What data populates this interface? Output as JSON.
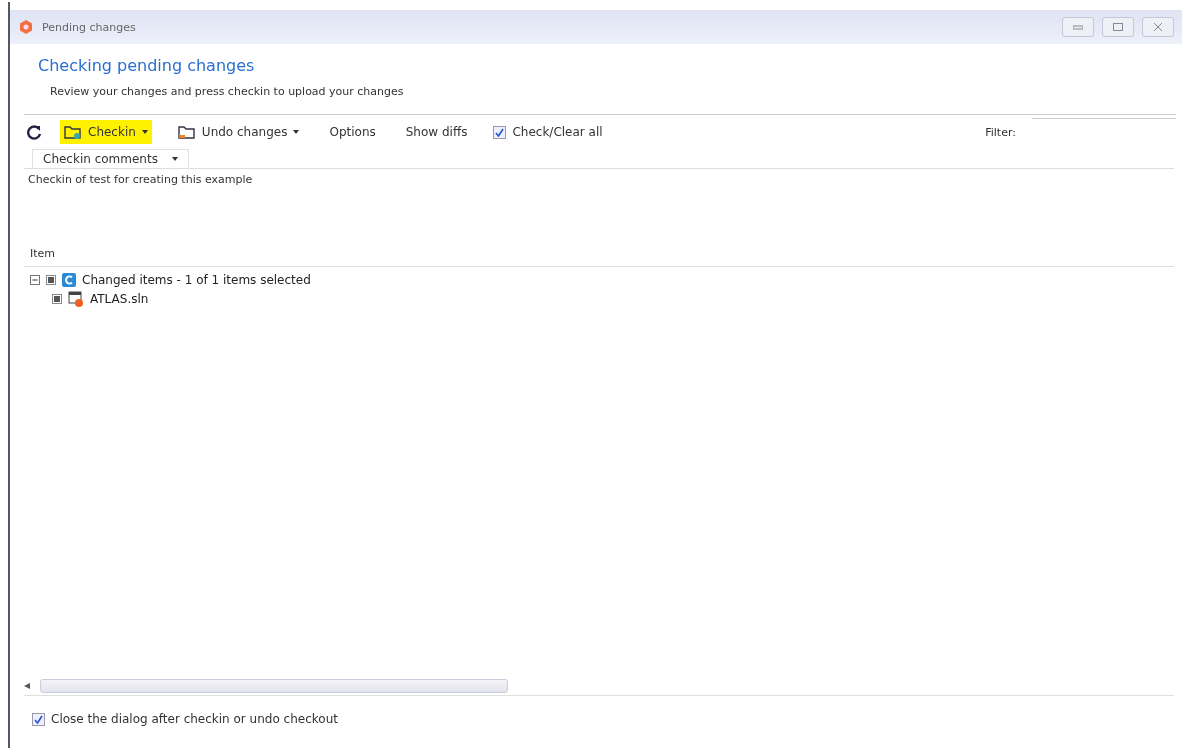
{
  "window": {
    "title": "Pending changes"
  },
  "header": {
    "title": "Checking pending changes",
    "subtitle": "Review your changes and press checkin to upload your changes"
  },
  "toolbar": [
    {
      "kind": "refresh"
    },
    {
      "kind": "button",
      "label": "Checkin",
      "dropdown": true,
      "highlighted": true
    },
    {
      "kind": "button",
      "label": "Undo changes",
      "dropdown": true,
      "highlighted": false
    },
    {
      "kind": "button",
      "label": "Options",
      "dropdown": false,
      "highlighted": false
    },
    {
      "kind": "button",
      "label": "Show diffs",
      "dropdown": false,
      "highlighted": false
    },
    {
      "kind": "checkbox",
      "label": "Check/Clear all",
      "checked": true
    }
  ],
  "filter": {
    "label": "Filter:"
  },
  "comments": {
    "tab": "Checkin comments",
    "value": "Checkin of test for creating this example"
  },
  "tree": {
    "column": "Item",
    "items": [
      {
        "label": "Changed items - 1 of 1 items selected",
        "checked": true,
        "expanded": true,
        "children": [
          {
            "label": "ATLAS.sln",
            "checked": true
          }
        ]
      }
    ]
  },
  "footer": {
    "label": "Close the dialog after checkin or undo checkout",
    "checked": true
  }
}
